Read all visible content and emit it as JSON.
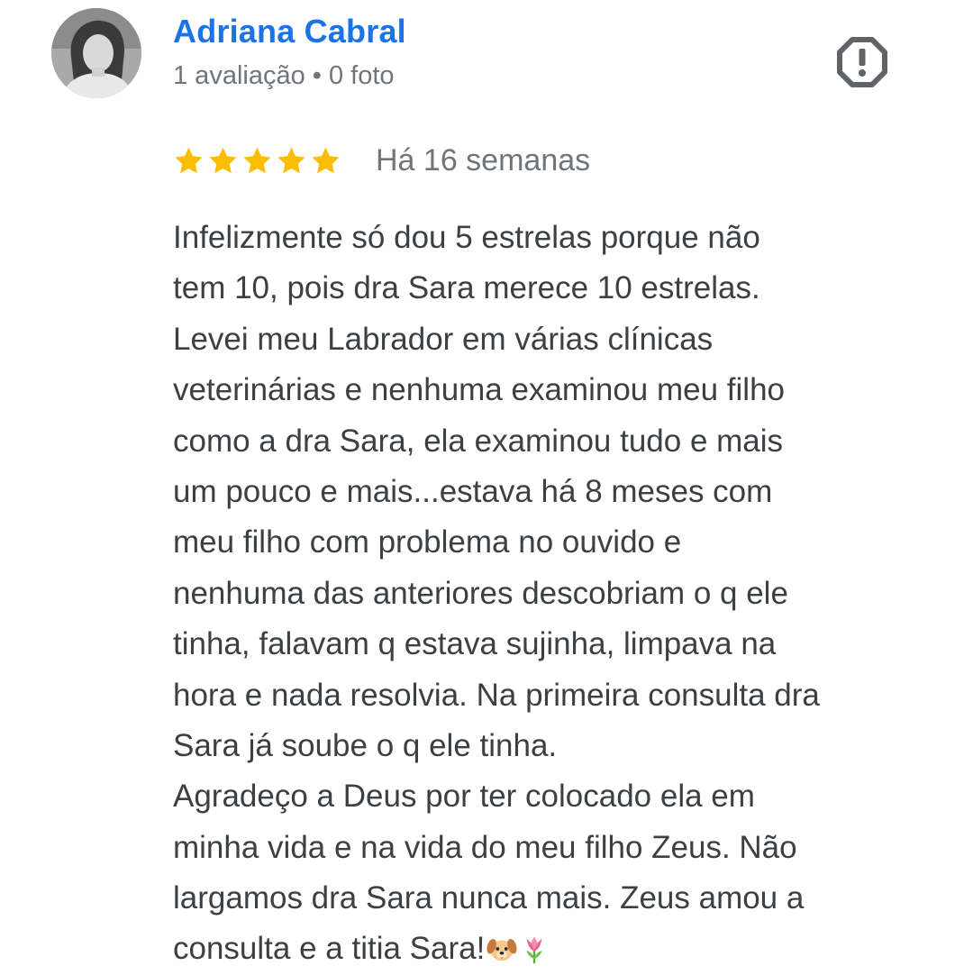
{
  "author": {
    "name": "Adriana Cabral",
    "meta": "1 avaliação • 0 foto"
  },
  "review": {
    "rating": 5,
    "rating_max": 5,
    "date": "Há 16 semanas",
    "lines": [
      "Infelizmente só dou 5 estrelas porque não",
      "tem 10, pois dra Sara merece 10 estrelas.",
      "Levei meu Labrador em várias clínicas",
      "veterinárias e nenhuma examinou meu filho",
      "como a dra Sara, ela examinou tudo e mais",
      "um pouco e mais...estava há 8 meses com",
      "meu filho com problema no ouvido e",
      "nenhuma das anteriores descobriam o q ele",
      "tinha, falavam q estava sujinha, limpava na",
      "hora e nada resolvia. Na primeira consulta dra",
      "Sara já soube o q ele tinha.",
      "Agradeço a Deus por ter colocado ela em",
      "minha vida e na vida do meu filho Zeus. Não",
      "largamos dra Sara nunca mais. Zeus amou a",
      "consulta e a titia Sara!"
    ],
    "trailing_emojis": [
      "dog-face-emoji",
      "tulip-emoji"
    ]
  },
  "icons": {
    "report": "report-octagon-icon",
    "star": "star-icon"
  },
  "colors": {
    "author_name": "#1a73e8",
    "meta_text": "#70757a",
    "body_text": "#3c4043",
    "star": "#fbbc04",
    "report_icon": "#5f6368"
  }
}
